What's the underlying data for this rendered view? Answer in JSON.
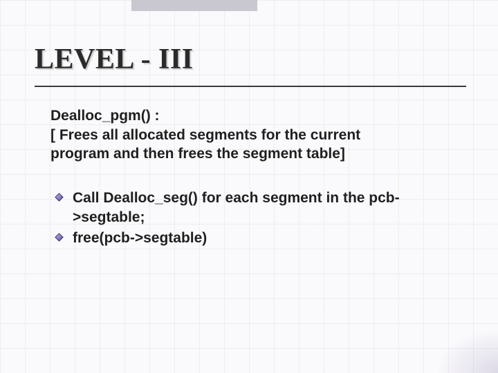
{
  "title": "LEVEL - III",
  "intro": {
    "line1": "Dealloc_pgm() :",
    "line2": "[  Frees all allocated segments for the current",
    "line3": "    program and then frees the segment table]"
  },
  "bullets": [
    "Call Dealloc_seg() for each segment in the pcb->segtable;",
    "free(pcb->segtable)"
  ],
  "colors": {
    "bullet_outline": "#2f2a6a",
    "bullet_fill_tl": "#c9c2f4",
    "bullet_fill_br": "#4e4498"
  }
}
